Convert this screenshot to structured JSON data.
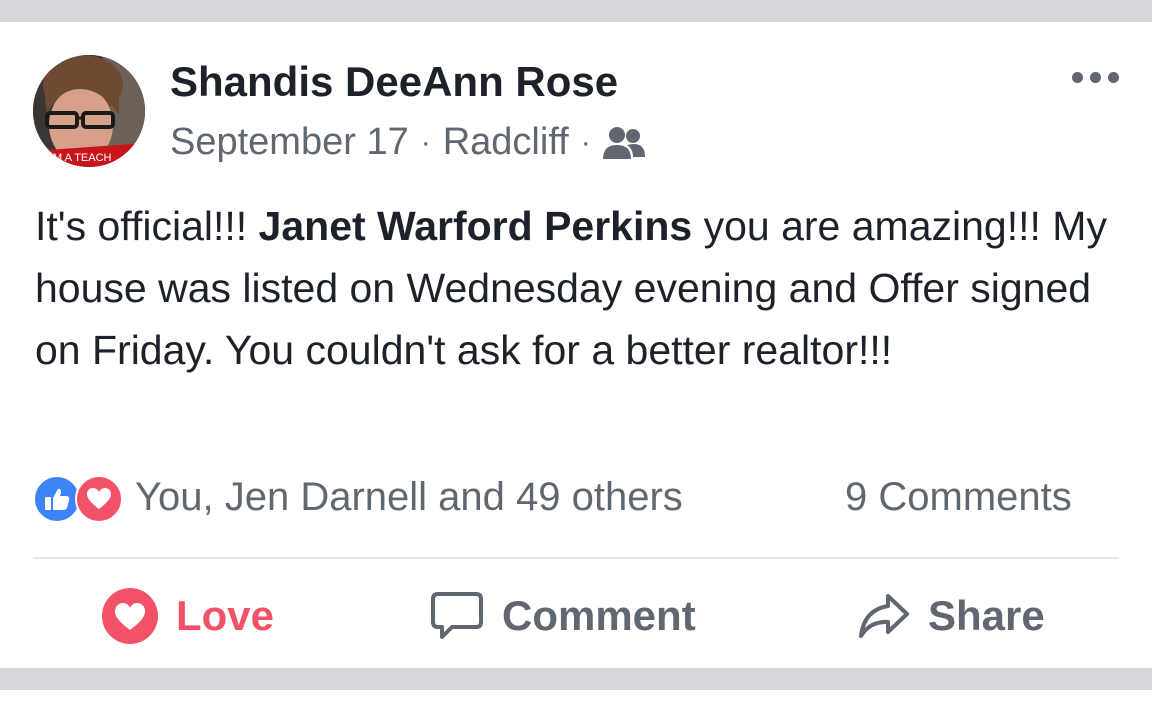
{
  "post": {
    "author": "Shandis DeeAnn Rose",
    "date": "September 17",
    "separator": "·",
    "location": "Radcliff",
    "audience_icon": "friends-icon",
    "avatar_banner_text": "M A TEACH",
    "text_intro": "It's official!!! ",
    "mention": "Janet Warford Perkins",
    "text_body": " you are amazing!!! My house was listed on Wednesday evening and Offer signed on Friday.  You couldn't ask for a better realtor!!!"
  },
  "reactions": {
    "icons": [
      "like-icon",
      "love-icon"
    ],
    "summary": "You, Jen Darnell and 49 others",
    "comments": "9 Comments"
  },
  "actions": {
    "love": "Love",
    "comment": "Comment",
    "share": "Share"
  },
  "colors": {
    "love": "#f25268",
    "like": "#3f83f8",
    "secondary_text": "#606770",
    "primary_text": "#1d2129",
    "band": "#d5d7db"
  }
}
